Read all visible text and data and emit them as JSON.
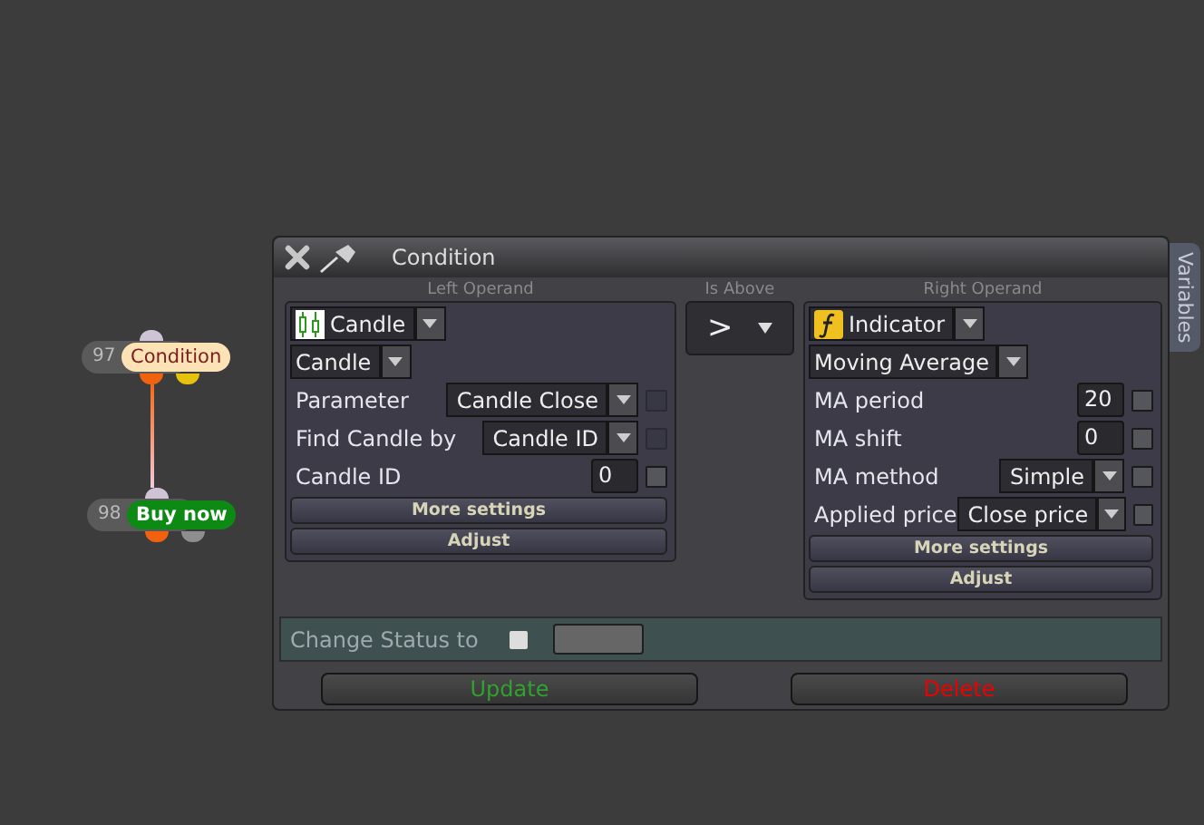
{
  "canvas": {
    "nodes": [
      {
        "number": "97",
        "label": "Condition",
        "kind": "condition"
      },
      {
        "number": "98",
        "label": "Buy now",
        "kind": "action"
      }
    ]
  },
  "dialog": {
    "title": "Condition",
    "variables_tab": "Variables",
    "left_operand": {
      "heading": "Left Operand",
      "type": "Candle",
      "kind": "candle",
      "subtype": "Candle",
      "params": [
        {
          "kind": "select",
          "label": "Parameter",
          "value": "Candle Close",
          "checked": false,
          "disabled": true
        },
        {
          "kind": "select",
          "label": "Find Candle by",
          "value": "Candle ID",
          "checked": false,
          "disabled": true
        },
        {
          "kind": "number",
          "label": "Candle ID",
          "value": "0",
          "checked": false,
          "disabled": false
        }
      ],
      "buttons": [
        "More settings",
        "Adjust"
      ]
    },
    "comparison": {
      "heading": "Is Above",
      "value": ">"
    },
    "right_operand": {
      "heading": "Right Operand",
      "type": "Indicator",
      "kind": "indicator",
      "subtype": "Moving Average",
      "params": [
        {
          "kind": "number",
          "label": "MA period",
          "value": "20",
          "checked": false,
          "disabled": false
        },
        {
          "kind": "number",
          "label": "MA shift",
          "value": "0",
          "checked": false,
          "disabled": false
        },
        {
          "kind": "select",
          "label": "MA method",
          "value": "Simple",
          "checked": false,
          "disabled": false
        },
        {
          "kind": "select",
          "label": "Applied price",
          "value": "Close price",
          "checked": false,
          "disabled": false
        }
      ],
      "buttons": [
        "More settings",
        "Adjust"
      ]
    },
    "change_status": {
      "label": "Change Status to",
      "checked": false
    },
    "buttons": [
      {
        "label": "Update",
        "kind": "update"
      },
      {
        "label": "Delete",
        "kind": "delete"
      }
    ]
  }
}
